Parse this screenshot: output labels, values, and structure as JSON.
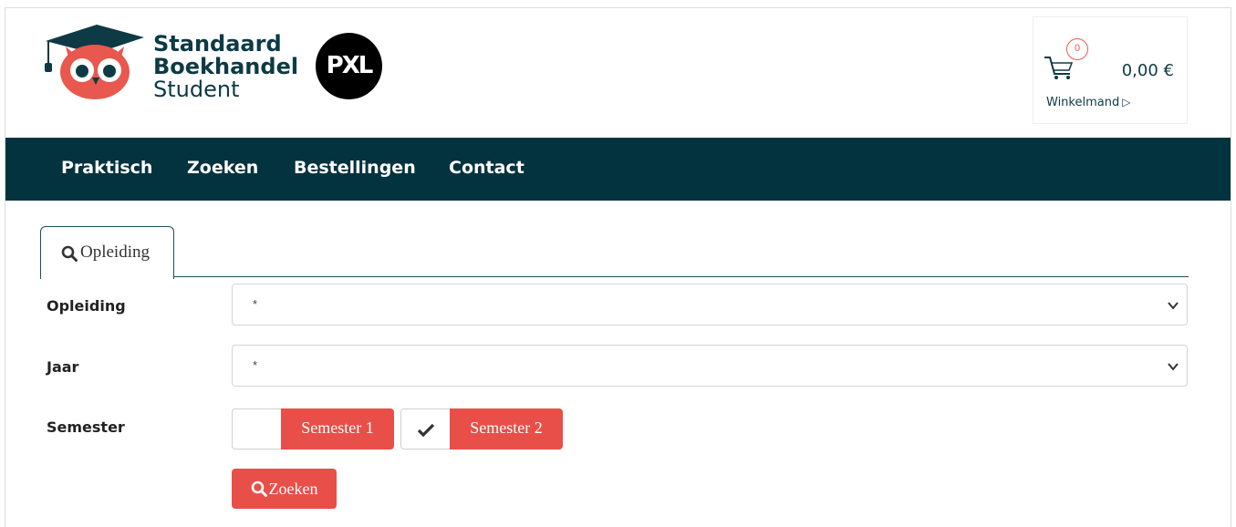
{
  "brand": {
    "line1": "Standaard",
    "line2": "Boekhandel",
    "line3": "Student",
    "partner_logo_text": "PXL",
    "primary_color": "#0d3a45",
    "accent_color": "#e84f48"
  },
  "cart": {
    "count": "0",
    "total": "0,00 €",
    "label": "Winkelmand"
  },
  "nav": {
    "items": [
      {
        "label": "Praktisch"
      },
      {
        "label": "Zoeken"
      },
      {
        "label": "Bestellingen"
      },
      {
        "label": "Contact"
      }
    ],
    "background": "#02333f"
  },
  "tab": {
    "label": "Opleiding",
    "icon": "search-icon"
  },
  "form": {
    "opleiding": {
      "label": "Opleiding",
      "value": "*"
    },
    "jaar": {
      "label": "Jaar",
      "value": "*"
    },
    "semester": {
      "label": "Semester",
      "options": [
        {
          "label": "Semester 1",
          "checked": false
        },
        {
          "label": "Semester 2",
          "checked": true
        }
      ]
    },
    "search_button": "Zoeken"
  }
}
